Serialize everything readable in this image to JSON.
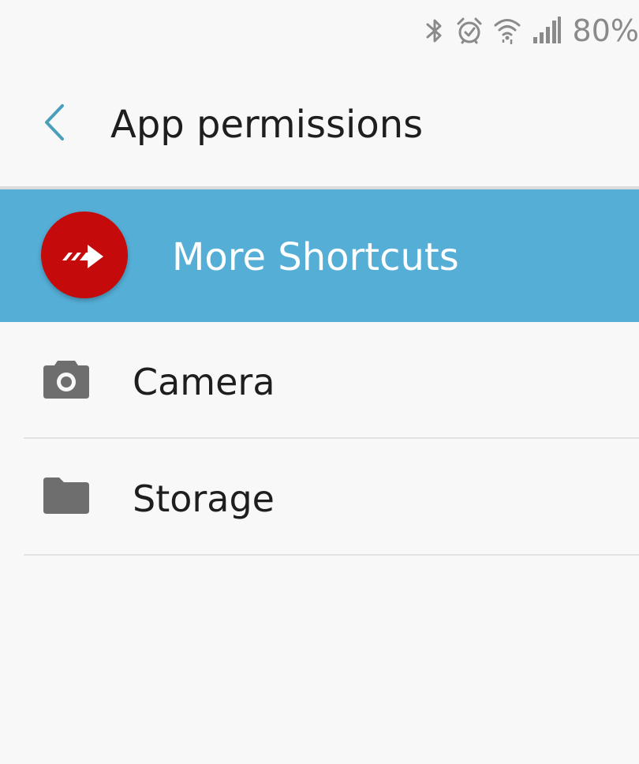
{
  "status_bar": {
    "battery_text": "80%",
    "icons": [
      "bluetooth-icon",
      "alarm-icon",
      "wifi-icon",
      "signal-icon"
    ]
  },
  "header": {
    "title": "App permissions",
    "back_icon": "chevron-left-icon"
  },
  "app": {
    "name": "More Shortcuts",
    "icon": "arrow-right-icon",
    "banner_color": "#55aed6",
    "icon_color": "#c40a0a"
  },
  "permissions": [
    {
      "label": "Camera",
      "icon": "camera-icon"
    },
    {
      "label": "Storage",
      "icon": "folder-icon"
    }
  ],
  "colors": {
    "accent": "#4a9fba",
    "icon_gray": "#6e6e6e",
    "background": "#f8f8f8"
  }
}
